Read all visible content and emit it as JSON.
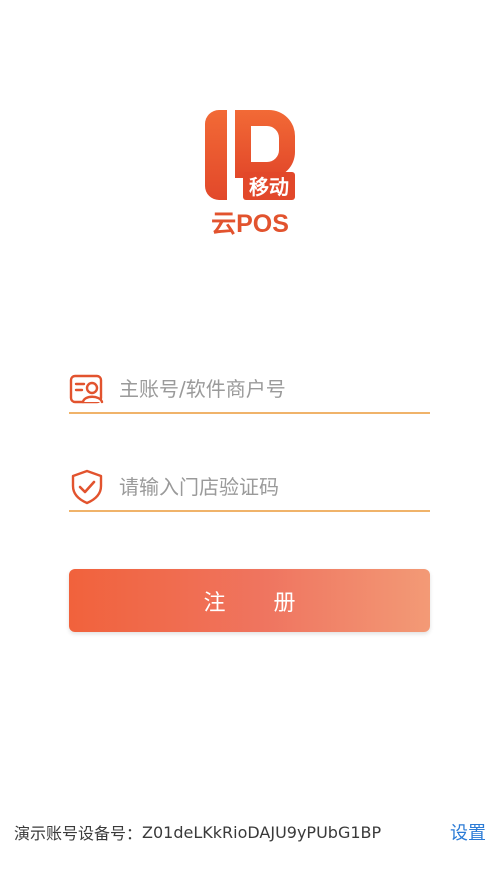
{
  "logo": {
    "badge_text": "移动",
    "brand_text": "云POS",
    "brand_color": "#e2532e"
  },
  "form": {
    "account": {
      "icon": "account-card-icon",
      "placeholder": "主账号/软件商户号",
      "value": ""
    },
    "code": {
      "icon": "shield-check-icon",
      "placeholder": "请输入门店验证码",
      "value": ""
    }
  },
  "register_button": {
    "label": "注册"
  },
  "footer": {
    "device_label": "演示账号设备号：",
    "device_id": "Z01deLKkRioDAJU9yPUbG1BP",
    "settings_label": "设置",
    "settings_color": "#2b7bd6"
  },
  "colors": {
    "accent": "#f1623c",
    "underline": "#f0b36a"
  }
}
